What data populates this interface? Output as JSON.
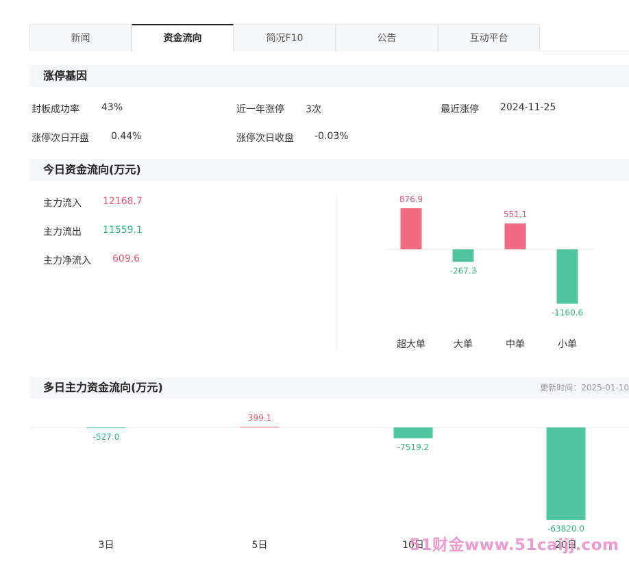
{
  "tabs": [
    {
      "label": "新闻",
      "active": false
    },
    {
      "label": "资金流向",
      "active": true
    },
    {
      "label": "简况F10",
      "active": false
    },
    {
      "label": "公告",
      "active": false
    },
    {
      "label": "互动平台",
      "active": false
    }
  ],
  "limit_gene": {
    "title": "涨停基因",
    "seal_rate_label": "封板成功率",
    "seal_rate_value": "43%",
    "year_limits_label": "近一年涨停",
    "year_limits_value": "3次",
    "recent_limit_label": "最近涨停",
    "recent_limit_value": "2024-11-25",
    "next_open_label": "涨停次日开盘",
    "next_open_value": "0.44%",
    "next_close_label": "涨停次日收盘",
    "next_close_value": "-0.03%"
  },
  "today_flow": {
    "title": "今日资金流向(万元)",
    "inflow_label": "主力流入",
    "inflow_value": "12168.7",
    "outflow_label": "主力流出",
    "outflow_value": "11559.1",
    "net_label": "主力净流入",
    "net_value": "609.6"
  },
  "multi_day": {
    "title": "多日主力资金流向(万元)",
    "update_time": "更新时间：2025-01-10"
  },
  "watermark": "51财金www.51caijj.com",
  "colors": {
    "positive": "#f06b80",
    "negative": "#52c5a0",
    "positive_text": "#e8546d",
    "negative_text": "#2eb58b"
  },
  "chart_data": [
    {
      "type": "bar",
      "categories": [
        "超大单",
        "大单",
        "中单",
        "小单"
      ],
      "values": [
        876.9,
        -267.3,
        551.1,
        -1160.6
      ],
      "value_labels": [
        "876.9",
        "-267.3",
        "551.1",
        "-1160.6"
      ]
    },
    {
      "type": "bar",
      "categories": [
        "3日",
        "5日",
        "10日",
        "20日"
      ],
      "values": [
        -527.0,
        399.1,
        -7519.2,
        -63820.0
      ],
      "value_labels": [
        "-527.0",
        "399.1",
        "-7519.2",
        "-63820.0"
      ]
    }
  ]
}
